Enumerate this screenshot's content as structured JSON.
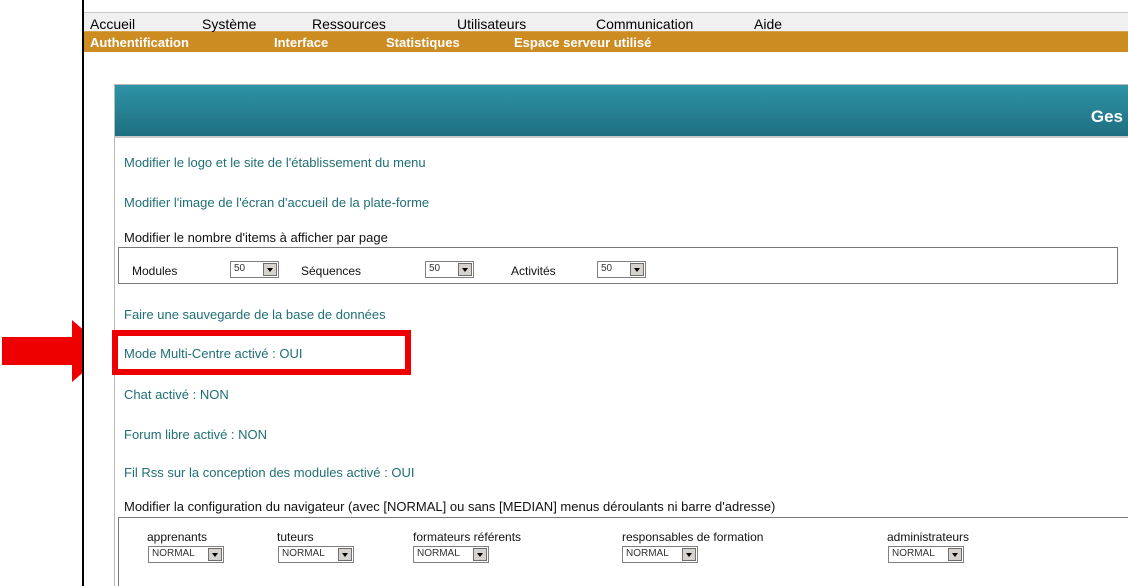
{
  "menu_primary": [
    "Accueil",
    "Système",
    "Ressources",
    "Utilisateurs",
    "Communication",
    "Aide"
  ],
  "menu_secondary": [
    "Authentification",
    "Interface",
    "Statistiques",
    "Espace serveur utilisé"
  ],
  "panel_title": "Ges",
  "links": {
    "logo": "Modifier le logo et le site de l'établissement du menu",
    "image": "Modifier l'image de l'écran d'accueil de la plate-forme",
    "items_heading": "Modifier le nombre d'items à afficher par page",
    "backup": "Faire une sauvegarde de la base de données",
    "multicentre": "Mode Multi-Centre activé : OUI",
    "chat": "Chat activé : NON",
    "forum": "Forum libre activé : NON",
    "rss": "Fil Rss sur la conception des modules activé : OUI",
    "browser_heading": "Modifier la configuration du navigateur (avec [NORMAL] ou sans [MEDIAN] menus déroulants ni barre d'adresse)"
  },
  "items_per_page": [
    {
      "label": "Modules",
      "value": "50"
    },
    {
      "label": "Séquences",
      "value": "50"
    },
    {
      "label": "Activités",
      "value": "50"
    }
  ],
  "browser_config": [
    {
      "label": "apprenants",
      "value": "NORMAL"
    },
    {
      "label": "tuteurs",
      "value": "NORMAL"
    },
    {
      "label": "formateurs référents",
      "value": "NORMAL"
    },
    {
      "label": "responsables de formation",
      "value": "NORMAL"
    },
    {
      "label": "administrateurs",
      "value": "NORMAL"
    }
  ],
  "colors": {
    "menu_bar": "#cc8c22",
    "header_teal": "#1d6f80",
    "link_teal": "#1f6f74",
    "highlight_red": "#ee0000"
  },
  "icons": {
    "arrow": "right-arrow-icon",
    "dropdown": "chevron-down-icon"
  }
}
